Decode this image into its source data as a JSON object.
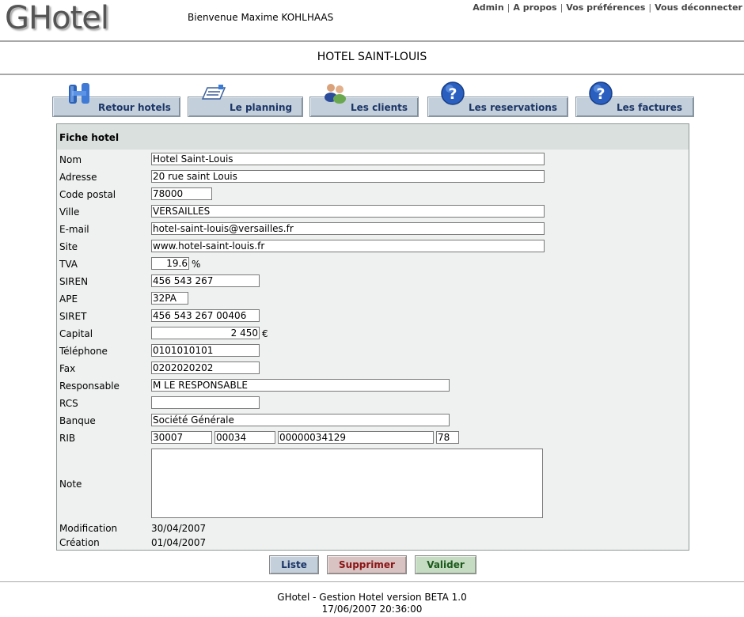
{
  "app": {
    "logo": "GHotel",
    "welcome": "Bienvenue Maxime KOHLHAAS"
  },
  "toplinks": [
    "Admin",
    "A propos",
    "Vos préférences",
    "Vous déconnecter"
  ],
  "page_title": "HOTEL SAINT-LOUIS",
  "nav": [
    {
      "label": "Retour hotels",
      "icon": "hotel-building-icon"
    },
    {
      "label": "Le planning",
      "icon": "planning-icon"
    },
    {
      "label": "Les clients",
      "icon": "clients-icon"
    },
    {
      "label": "Les reservations",
      "icon": "help-question-icon"
    },
    {
      "label": "Les factures",
      "icon": "help-question-icon"
    }
  ],
  "form": {
    "title": "Fiche hotel",
    "labels": {
      "nom": "Nom",
      "adresse": "Adresse",
      "code_postal": "Code postal",
      "ville": "Ville",
      "email": "E-mail",
      "site": "Site",
      "tva": "TVA",
      "siren": "SIREN",
      "ape": "APE",
      "siret": "SIRET",
      "capital": "Capital",
      "telephone": "Téléphone",
      "fax": "Fax",
      "responsable": "Responsable",
      "rcs": "RCS",
      "banque": "Banque",
      "rib": "RIB",
      "note": "Note",
      "modification": "Modification",
      "creation": "Création"
    },
    "values": {
      "nom": "Hotel Saint-Louis",
      "adresse": "20 rue saint Louis",
      "code_postal": "78000",
      "ville": "VERSAILLES",
      "email": "hotel-saint-louis@versailles.fr",
      "site": "www.hotel-saint-louis.fr",
      "tva": "19.6",
      "tva_unit": "%",
      "siren": "456 543 267",
      "ape": "32PA",
      "siret": "456 543 267 00406",
      "capital": "2 450",
      "capital_unit": "€",
      "telephone": "0101010101",
      "fax": "0202020202",
      "responsable": "M LE RESPONSABLE",
      "rcs": "",
      "banque": "Société Générale",
      "rib_banque": "30007",
      "rib_guichet": "00034",
      "rib_compte": "00000034129",
      "rib_cle": "78",
      "note": "",
      "modification": "30/04/2007",
      "creation": "01/04/2007"
    }
  },
  "actions": {
    "liste": "Liste",
    "supprimer": "Supprimer",
    "valider": "Valider",
    "colors": {
      "liste": "#c3cfda",
      "supprimer": "#d9c2c2",
      "valider": "#c5dcc2"
    },
    "text_colors": {
      "liste": "#1b3567",
      "supprimer": "#8a1414",
      "valider": "#1c5a1c"
    }
  },
  "footer": {
    "line1": "GHotel - Gestion Hotel version BETA 1.0",
    "line2": "17/06/2007 20:36:00"
  }
}
